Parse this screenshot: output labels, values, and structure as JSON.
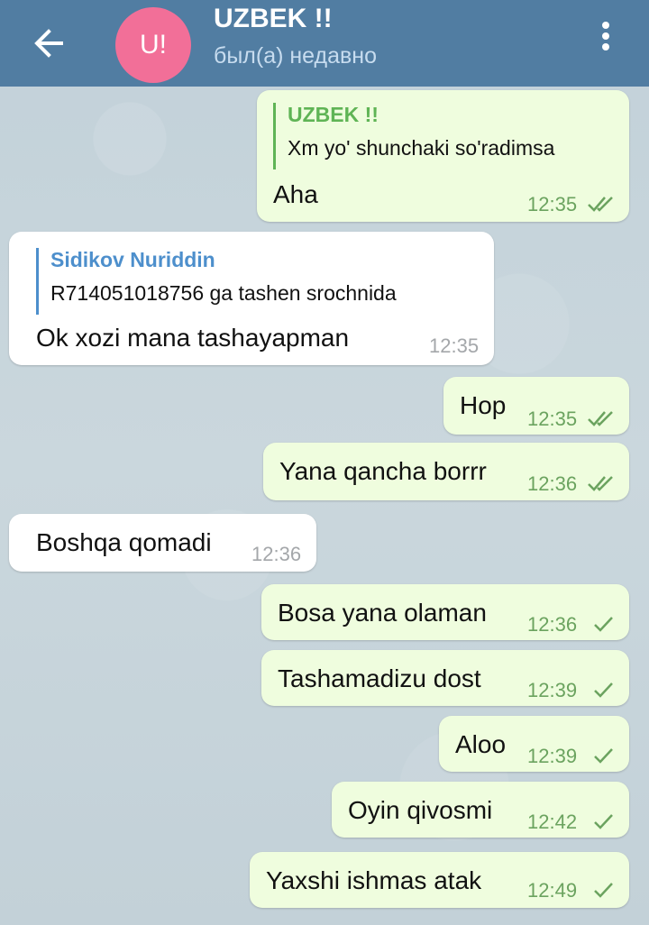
{
  "header": {
    "avatar_initials": "U!",
    "title": "UZBEK !!",
    "status": "был(а) недавно",
    "avatar_color": "#f26f98",
    "bar_color": "#517da2",
    "back_icon": "arrow-left-icon",
    "menu_icon": "more-vertical-icon"
  },
  "messages": [
    {
      "direction": "out",
      "reply_name": "UZBEK !!",
      "reply_text": "Xm yo' shunchaki so'radimsa",
      "text": "Aha",
      "time": "12:35",
      "status": "read"
    },
    {
      "direction": "in",
      "reply_name": "Sidikov Nuriddin",
      "reply_text": "R714051018756 ga tashen srochnida",
      "text": "Ok xozi mana tashayapman",
      "time": "12:35"
    },
    {
      "direction": "out",
      "text": "Hop",
      "time": "12:35",
      "status": "read"
    },
    {
      "direction": "out",
      "text": "Yana qancha borrr",
      "time": "12:36",
      "status": "read"
    },
    {
      "direction": "in",
      "text": "Boshqa qomadi",
      "time": "12:36"
    },
    {
      "direction": "out",
      "text": "Bosa yana olaman",
      "time": "12:36",
      "status": "sent"
    },
    {
      "direction": "out",
      "text": "Tashamadizu dost",
      "time": "12:39",
      "status": "sent"
    },
    {
      "direction": "out",
      "text": "Aloo",
      "time": "12:39",
      "status": "sent"
    },
    {
      "direction": "out",
      "text": "Oyin qivosmi",
      "time": "12:42",
      "status": "sent"
    },
    {
      "direction": "out",
      "text": "Yaxshi ishmas atak",
      "time": "12:49",
      "status": "sent"
    }
  ],
  "colors": {
    "out_bubble": "#effdde",
    "in_bubble": "#ffffff",
    "out_reply_accent": "#5fb455",
    "in_reply_accent": "#4d8fcc",
    "out_time": "#6ba35f"
  }
}
